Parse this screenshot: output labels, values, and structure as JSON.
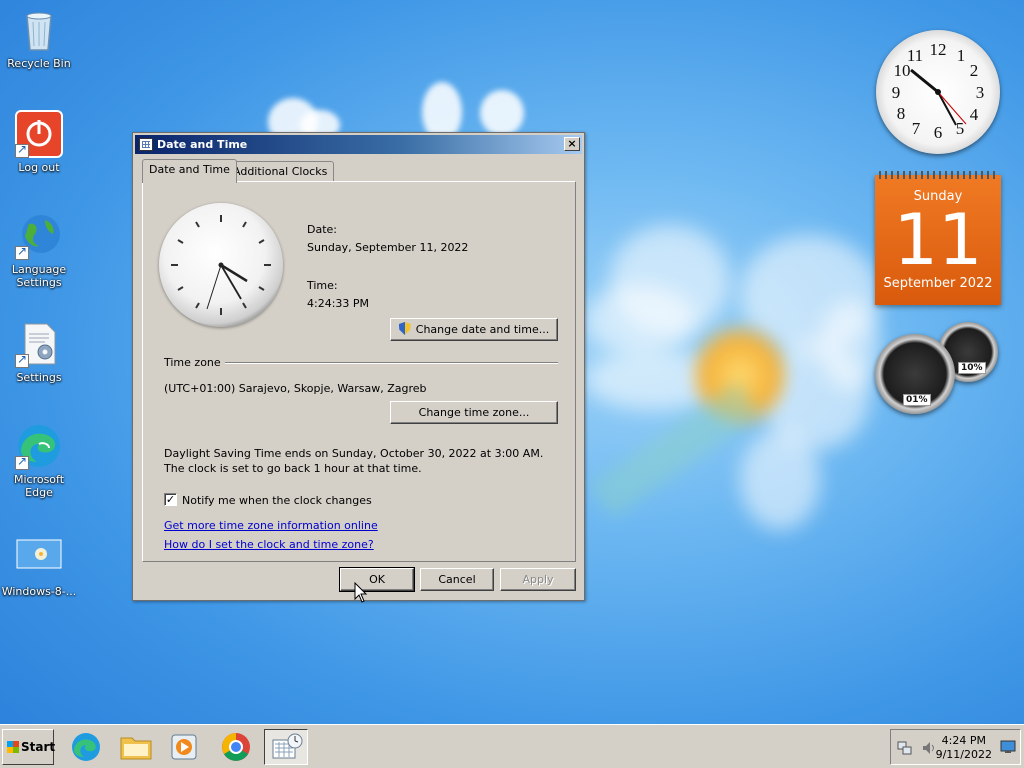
{
  "desktop": {
    "icons": [
      {
        "label": "Recycle Bin",
        "icon": "recycle-bin-icon"
      },
      {
        "label": "Log out",
        "icon": "power-icon"
      },
      {
        "label": "Language Settings",
        "icon": "globe-icon"
      },
      {
        "label": "Settings",
        "icon": "settings-document-icon"
      },
      {
        "label": "Microsoft Edge",
        "icon": "edge-icon"
      },
      {
        "label": "Windows-8-...",
        "icon": "image-file-icon"
      }
    ]
  },
  "gadgets": {
    "calendar": {
      "weekday": "Sunday",
      "day": "11",
      "month_year": "September 2022"
    },
    "cpu_meter": {
      "cpu": "01%",
      "memory": "10%"
    }
  },
  "window": {
    "title": "Date and Time",
    "tabs": [
      "Date and Time",
      "Additional Clocks"
    ],
    "date_label": "Date:",
    "date_value": "Sunday, September 11, 2022",
    "time_label": "Time:",
    "time_value": "4:24:33 PM",
    "change_date_button": "Change date and time...",
    "timezone_header": "Time zone",
    "timezone_value": "(UTC+01:00) Sarajevo, Skopje, Warsaw, Zagreb",
    "change_timezone_button": "Change time zone...",
    "dst_text": "Daylight Saving Time ends on Sunday, October 30, 2022 at 3:00 AM. The clock is set to go back 1 hour at that time.",
    "notify_label": "Notify me when the clock changes",
    "notify_checked": true,
    "link_more_info": "Get more time zone information online",
    "link_how_to": "How do I set the clock and time zone?",
    "ok": "OK",
    "cancel": "Cancel",
    "apply": "Apply"
  },
  "taskbar": {
    "start_label": "Start",
    "apps": [
      "edge-icon",
      "folder-icon",
      "media-player-icon",
      "chrome-icon",
      "date-time-icon"
    ],
    "clock_time": "4:24 PM",
    "clock_date": "9/11/2022"
  },
  "colors": {
    "desktop_blue": "#3f97e6",
    "title_blue": "#0a246a",
    "calendar_orange": "#e8641a",
    "link_blue": "#0000d0"
  }
}
